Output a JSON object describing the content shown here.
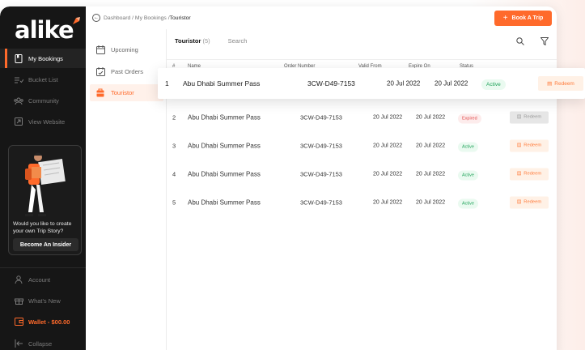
{
  "sidebar": {
    "logo": "alike",
    "items": [
      {
        "label": "My Bookings",
        "icon": "bookmark-icon",
        "active": true
      },
      {
        "label": "Bucket List",
        "icon": "list-check-icon"
      },
      {
        "label": "Community",
        "icon": "users-icon"
      },
      {
        "label": "View Website",
        "icon": "external-link-icon"
      }
    ],
    "promo": {
      "text": "Would you like to create your own Trip Story?",
      "button": "Become An Insider"
    },
    "bottom": [
      {
        "label": "Account",
        "icon": "user-icon"
      },
      {
        "label": "What's New",
        "icon": "gift-icon"
      },
      {
        "label": "Wallet - $00.00",
        "icon": "wallet-icon"
      },
      {
        "label": "Collapse",
        "icon": "collapse-icon"
      }
    ]
  },
  "breadcrumb": {
    "path": "Dashboard / My Bookings / ",
    "current": "Touristor"
  },
  "book_button": "Book A Trip",
  "subnav": [
    {
      "label": "Upcoming",
      "icon": "calendar-icon"
    },
    {
      "label": "Past Orders",
      "icon": "calendar-check-icon"
    },
    {
      "label": "Touristor",
      "icon": "ticket-icon",
      "active": true
    }
  ],
  "tabs": {
    "active": "Touristor",
    "count": "(5)",
    "search": "Search"
  },
  "table": {
    "headers": [
      "#",
      "Name",
      "Order Number",
      "Valid From",
      "Expire On",
      "Status"
    ],
    "redeem_label": "Redeem",
    "rows": [
      {
        "idx": "1",
        "name": "Abu Dhabi Summer Pass",
        "order": "3CW-D49-7153",
        "valid": "20 Jul 2022",
        "expire": "20 Jul 2022",
        "status": "Active"
      },
      {
        "idx": "2",
        "name": "Abu Dhabi Summer Pass",
        "order": "3CW-D49-7153",
        "valid": "20 Jul 2022",
        "expire": "20 Jul 2022",
        "status": "Expired"
      },
      {
        "idx": "3",
        "name": "Abu Dhabi Summer Pass",
        "order": "3CW-D49-7153",
        "valid": "20 Jul 2022",
        "expire": "20 Jul 2022",
        "status": "Active"
      },
      {
        "idx": "4",
        "name": "Abu Dhabi Summer Pass",
        "order": "3CW-D49-7153",
        "valid": "20 Jul 2022",
        "expire": "20 Jul 2022",
        "status": "Active"
      },
      {
        "idx": "5",
        "name": "Abu Dhabi Summer Pass",
        "order": "3CW-D49-7153",
        "valid": "20 Jul 2022",
        "expire": "20 Jul 2022",
        "status": "Active"
      }
    ]
  },
  "colors": {
    "accent": "#ff6a2b",
    "sidebar_bg": "#161616",
    "active_green": "#20a35a",
    "expired_red": "#e24c4c"
  }
}
